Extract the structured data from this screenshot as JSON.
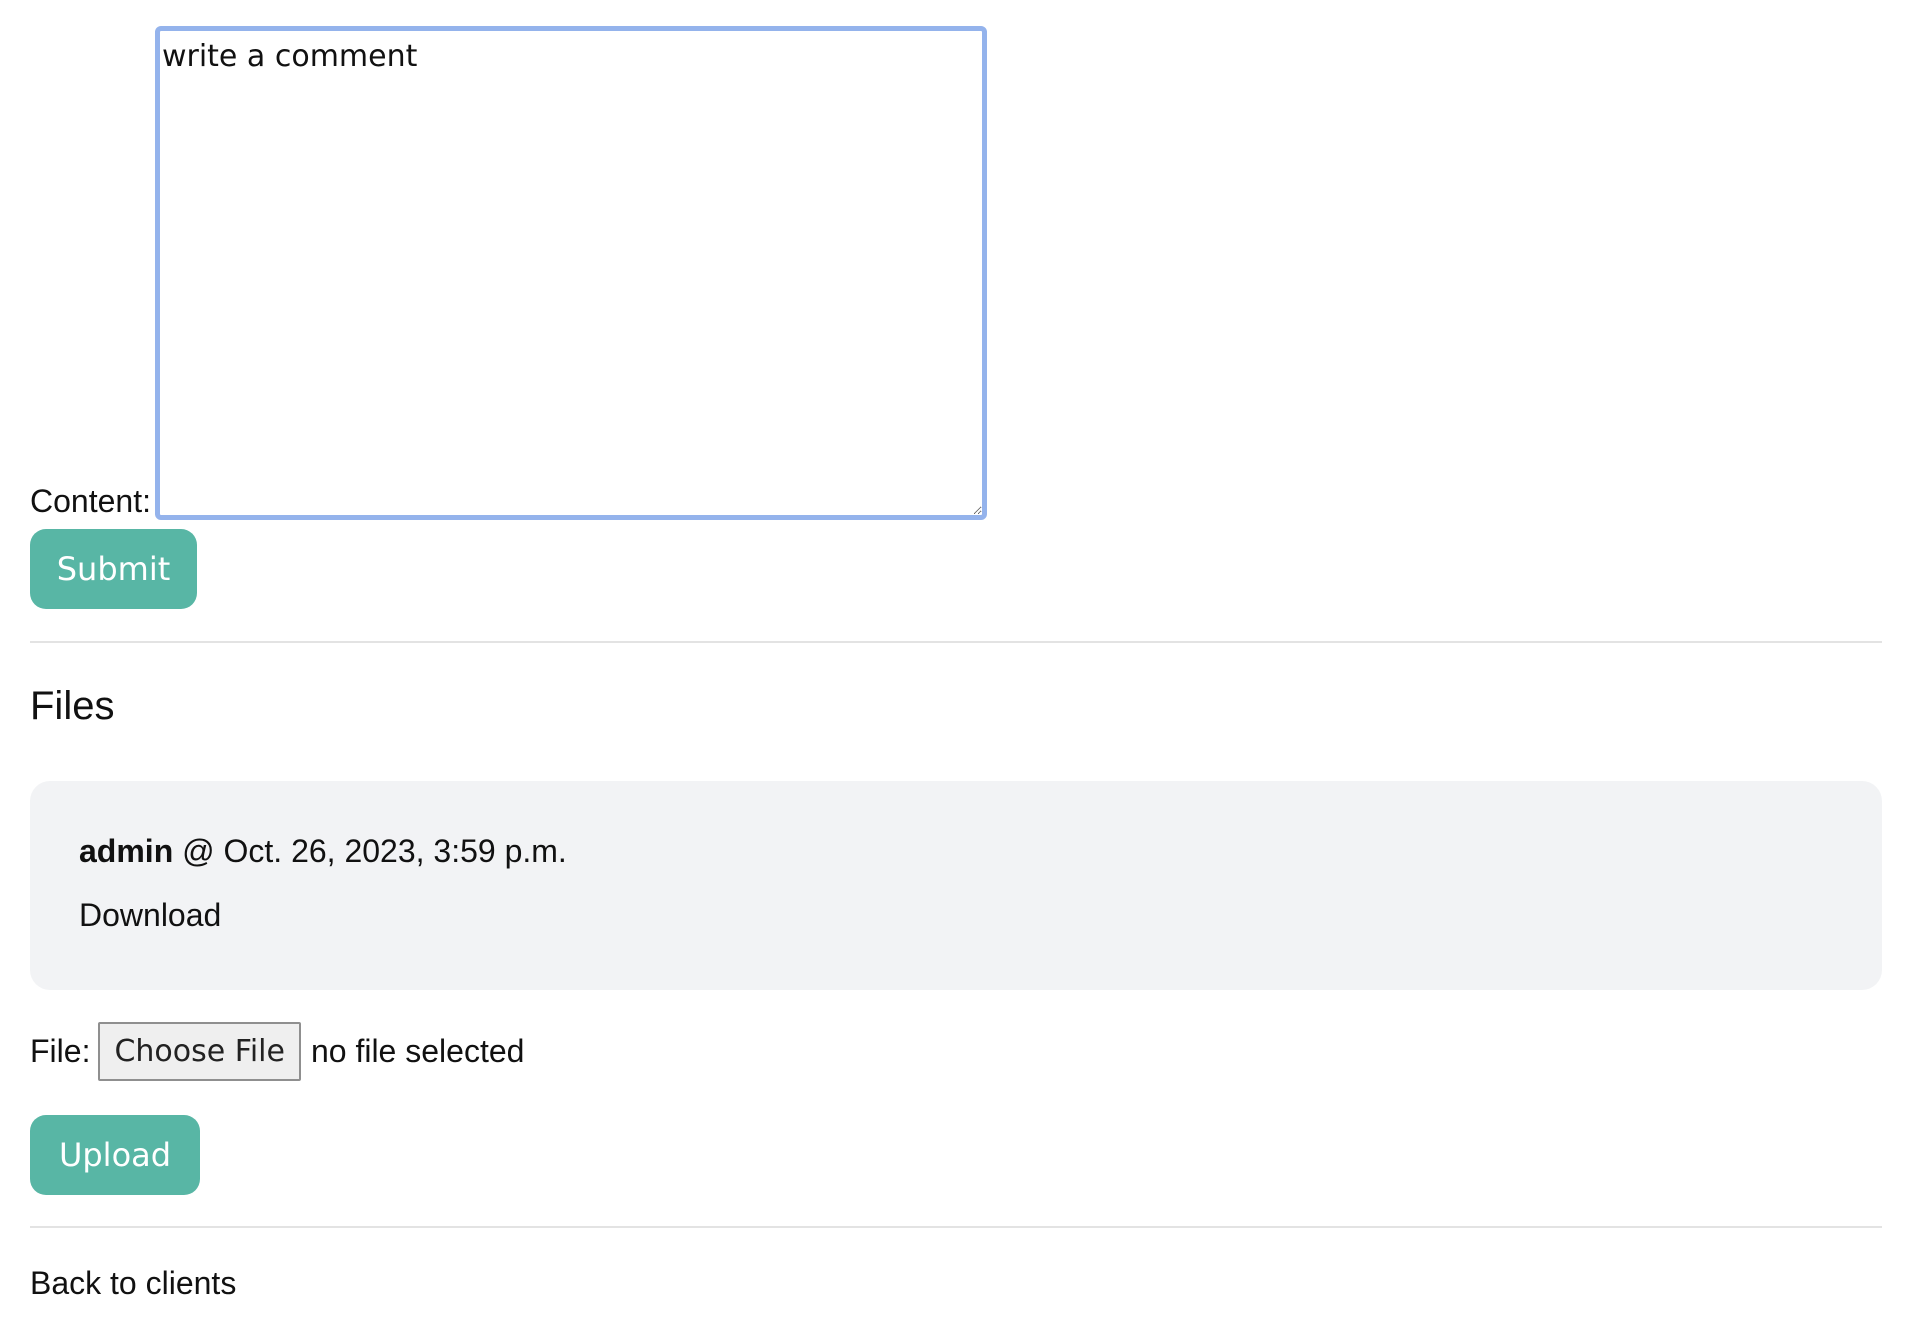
{
  "comment_form": {
    "content_label": "Content:",
    "textarea_value": "write a comment",
    "submit_label": "Submit"
  },
  "files": {
    "heading": "Files",
    "items": [
      {
        "author": "admin",
        "separator": " @ ",
        "timestamp": "Oct. 26, 2023, 3:59 p.m.",
        "download_label": "Download"
      }
    ]
  },
  "upload_form": {
    "file_label": "File:",
    "choose_file_label": "Choose File",
    "no_file_text": "no file selected",
    "upload_label": "Upload"
  },
  "footer": {
    "back_link": "Back to clients"
  },
  "colors": {
    "button": "#58b6a5",
    "textarea_focus_border": "#94b3ec",
    "card_background": "#f2f3f5"
  }
}
